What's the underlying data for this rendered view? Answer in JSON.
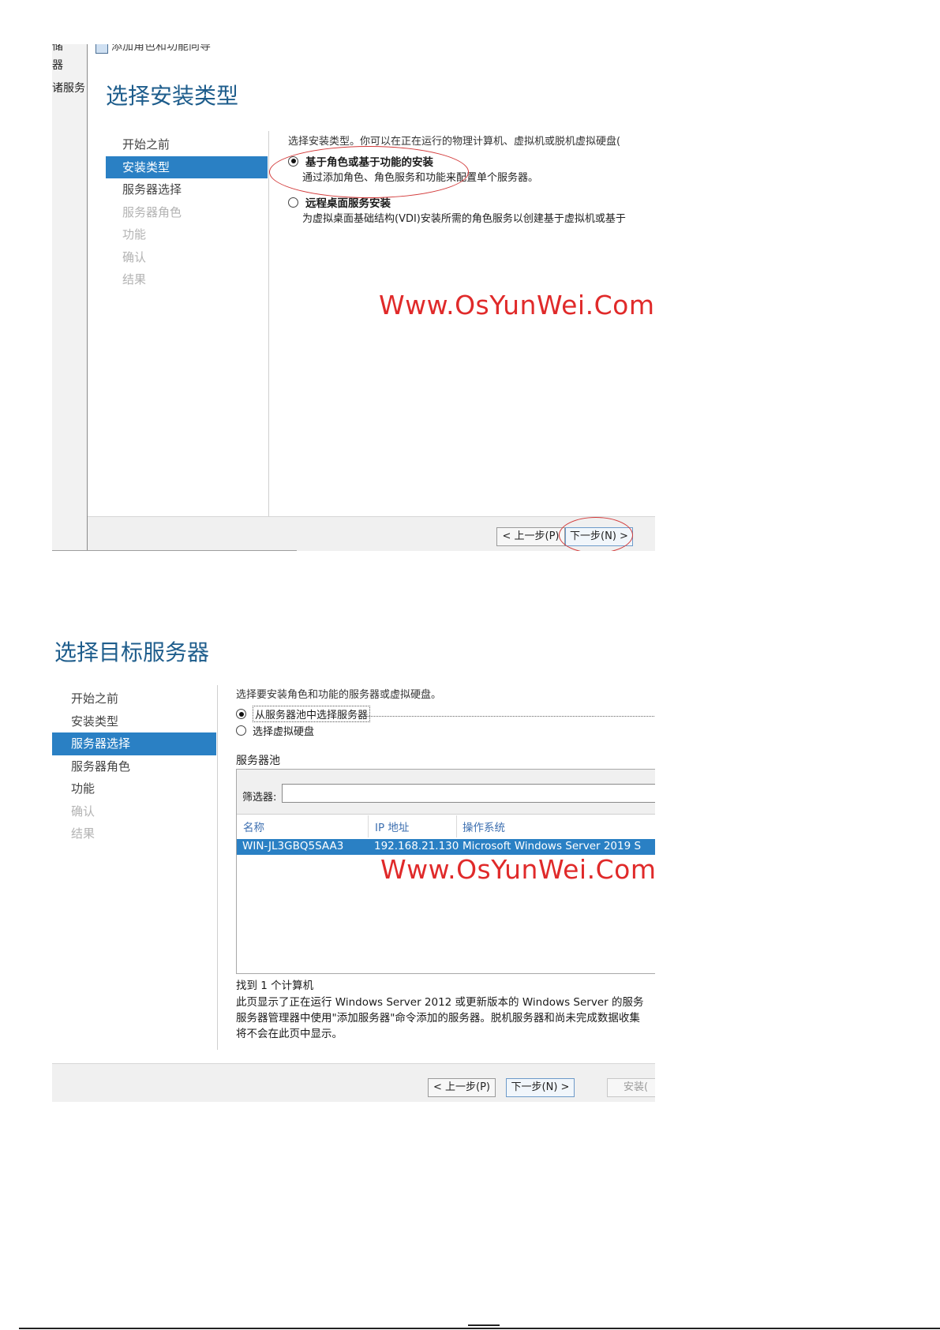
{
  "screenshot1": {
    "left_strip": [
      "储",
      "器",
      "诸服务"
    ],
    "window_title": "添加角色和功能向导",
    "heading": "选择安装类型",
    "nav": [
      {
        "label": "开始之前",
        "state": "normal"
      },
      {
        "label": "安装类型",
        "state": "active"
      },
      {
        "label": "服务器选择",
        "state": "normal"
      },
      {
        "label": "服务器角色",
        "state": "disabled"
      },
      {
        "label": "功能",
        "state": "disabled"
      },
      {
        "label": "确认",
        "state": "disabled"
      },
      {
        "label": "结果",
        "state": "disabled"
      }
    ],
    "intro": "选择安装类型。你可以在正在运行的物理计算机、虚拟机或脱机虚拟硬盘(",
    "options": [
      {
        "label": "基于角色或基于功能的安装",
        "desc": "通过添加角色、角色服务和功能来配置单个服务器。",
        "selected": true
      },
      {
        "label": "远程桌面服务安装",
        "desc": "为虚拟桌面基础结构(VDI)安装所需的角色服务以创建基于虚拟机或基于",
        "selected": false
      }
    ],
    "watermark": "Www.OsYunWei.Com",
    "buttons": {
      "prev": "< 上一步(P)",
      "next": "下一步(N) >"
    }
  },
  "screenshot2": {
    "heading": "选择目标服务器",
    "nav": [
      {
        "label": "开始之前",
        "state": "normal"
      },
      {
        "label": "安装类型",
        "state": "normal"
      },
      {
        "label": "服务器选择",
        "state": "active"
      },
      {
        "label": "服务器角色",
        "state": "normal"
      },
      {
        "label": "功能",
        "state": "normal"
      },
      {
        "label": "确认",
        "state": "disabled"
      },
      {
        "label": "结果",
        "state": "disabled"
      }
    ],
    "intro": "选择要安装角色和功能的服务器或虚拟硬盘。",
    "options": [
      {
        "label": "从服务器池中选择服务器",
        "selected": true
      },
      {
        "label": "选择虚拟硬盘",
        "selected": false
      }
    ],
    "pool_label": "服务器池",
    "filter_label": "筛选器:",
    "filter_value": "",
    "columns": [
      "名称",
      "IP 地址",
      "操作系统"
    ],
    "rows": [
      {
        "name": "WIN-JL3GBQ5SAA3",
        "ip": "192.168.21.130",
        "os": "Microsoft Windows Server 2019 S"
      }
    ],
    "watermark": "Www.OsYunWei.Com",
    "found": "找到 1 个计算机",
    "description": [
      "此页显示了正在运行 Windows Server 2012 或更新版本的 Windows Server 的服务",
      "服务器管理器中使用\"添加服务器\"命令添加的服务器。脱机服务器和尚未完成数据收集",
      "将不会在此页中显示。"
    ],
    "buttons": {
      "prev": "< 上一步(P)",
      "next": "下一步(N) >",
      "install": "安装("
    }
  }
}
